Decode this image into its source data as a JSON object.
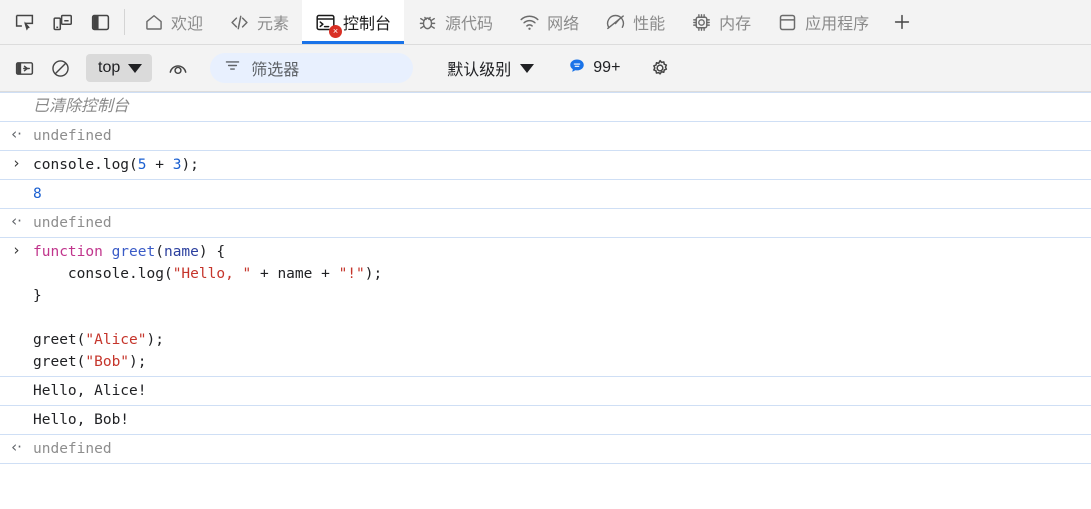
{
  "tabbar": {
    "tool_icons": [
      {
        "name": "inspect-element-icon",
        "title": "检查元素"
      },
      {
        "name": "device-toolbar-icon",
        "title": "设备工具栏"
      },
      {
        "name": "dock-panel-icon",
        "title": "停靠面板"
      }
    ],
    "tabs": [
      {
        "label": "欢迎",
        "icon": "home-icon",
        "active": false
      },
      {
        "label": "元素",
        "icon": "code-brackets-icon",
        "active": false
      },
      {
        "label": "控制台",
        "icon": "console-terminal-icon",
        "active": true,
        "error_badge": "×"
      },
      {
        "label": "源代码",
        "icon": "bug-icon",
        "active": false
      },
      {
        "label": "网络",
        "icon": "wifi-icon",
        "active": false
      },
      {
        "label": "性能",
        "icon": "gauge-icon",
        "active": false
      },
      {
        "label": "内存",
        "icon": "chip-icon",
        "active": false
      },
      {
        "label": "应用程序",
        "icon": "box-icon",
        "active": false
      }
    ],
    "add_tab_label": "+"
  },
  "console_toolbar": {
    "sidebar_toggle_icon": "show-console-sidebar-icon",
    "clear_icon": "clear-console-icon",
    "context_label": "top",
    "live_expression_icon": "eye-live-expression-icon",
    "filter": {
      "icon": "filter-icon",
      "placeholder": "筛选器",
      "value": ""
    },
    "level_label": "默认级别",
    "issues": {
      "icon": "issues-bubble-icon",
      "count": "99+"
    },
    "settings_icon": "gear-icon"
  },
  "console_rows": [
    {
      "id": "console-cleared",
      "gutter": "",
      "kind": "cleared",
      "text": "已清除控制台"
    },
    {
      "id": "result-undefined-1",
      "gutter": "‹·",
      "kind": "result",
      "text": "undefined"
    },
    {
      "id": "input-console-log",
      "gutter": "›",
      "kind": "input",
      "tokens": [
        {
          "t": "console.log(",
          "c": "plain"
        },
        {
          "t": "5",
          "c": "num"
        },
        {
          "t": " + ",
          "c": "plain"
        },
        {
          "t": "3",
          "c": "num"
        },
        {
          "t": ");",
          "c": "plain"
        }
      ]
    },
    {
      "id": "output-8",
      "gutter": "",
      "kind": "output-num",
      "text": "8"
    },
    {
      "id": "result-undefined-2",
      "gutter": "‹·",
      "kind": "result",
      "text": "undefined"
    },
    {
      "id": "input-function-greet",
      "gutter": "›",
      "kind": "input-multiline",
      "lines": [
        [
          {
            "t": "function ",
            "c": "kw"
          },
          {
            "t": "greet",
            "c": "fn"
          },
          {
            "t": "(",
            "c": "plain"
          },
          {
            "t": "name",
            "c": "param"
          },
          {
            "t": ") {",
            "c": "plain"
          }
        ],
        [
          {
            "t": "    console.log(",
            "c": "plain"
          },
          {
            "t": "\"Hello, \"",
            "c": "str"
          },
          {
            "t": " + name + ",
            "c": "plain"
          },
          {
            "t": "\"!\"",
            "c": "str"
          },
          {
            "t": ");",
            "c": "plain"
          }
        ],
        [
          {
            "t": "}",
            "c": "plain"
          }
        ],
        [
          {
            "t": "",
            "c": "plain"
          }
        ],
        [
          {
            "t": "greet(",
            "c": "plain"
          },
          {
            "t": "\"Alice\"",
            "c": "str"
          },
          {
            "t": ");",
            "c": "plain"
          }
        ],
        [
          {
            "t": "greet(",
            "c": "plain"
          },
          {
            "t": "\"Bob\"",
            "c": "str"
          },
          {
            "t": ");",
            "c": "plain"
          }
        ]
      ]
    },
    {
      "id": "output-hello-alice",
      "gutter": "",
      "kind": "output",
      "text": "Hello, Alice!"
    },
    {
      "id": "output-hello-bob",
      "gutter": "",
      "kind": "output",
      "text": "Hello, Bob!"
    },
    {
      "id": "result-undefined-3",
      "gutter": "‹·",
      "kind": "result",
      "text": "undefined"
    }
  ],
  "colors": {
    "accent": "#1a73e8",
    "error": "#d93025",
    "toolbar_bg": "#f3f3f3",
    "row_divider": "#cfdff5",
    "string": "#c5352b",
    "keyword": "#c0358c",
    "number": "#1a5fd0"
  }
}
